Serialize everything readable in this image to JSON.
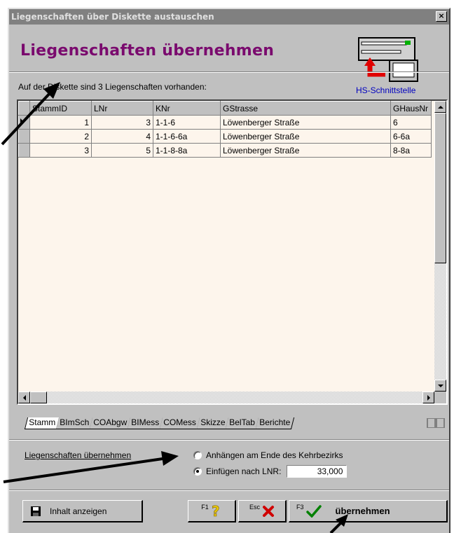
{
  "window": {
    "title": "Liegenschaften über Diskette austauschen",
    "close_glyph": "×"
  },
  "header": {
    "heading": "Liegenschaften übernehmen",
    "interface_label": "HS-Schnittstelle",
    "interface_icon": "computer-transfer-icon"
  },
  "info_text": "Auf der Diskette sind 3 Liegenschaften vorhanden:",
  "grid": {
    "columns": [
      "StammID",
      "LNr",
      "KNr",
      "GStrasse",
      "GHausNr"
    ],
    "rows": [
      {
        "stammid": "1",
        "lnr": "3",
        "knr": "1-1-6",
        "gstrasse": "Löwenberger Straße",
        "ghausnr": "6",
        "current": true
      },
      {
        "stammid": "2",
        "lnr": "4",
        "knr": "1-1-6-6a",
        "gstrasse": "Löwenberger Straße",
        "ghausnr": "6-6a",
        "current": false
      },
      {
        "stammid": "3",
        "lnr": "5",
        "knr": "1-1-8-8a",
        "gstrasse": "Löwenberger Straße",
        "ghausnr": "8-8a",
        "current": false
      }
    ]
  },
  "tabs": [
    "Stamm",
    "BImSch",
    "COAbgw",
    "BIMess",
    "COMess",
    "Skizze",
    "BelTab",
    "Berichte"
  ],
  "active_tab": "Stamm",
  "options": {
    "label": "Liegenschaften übernehmen",
    "radio_append": "Anhängen am Ende des Kehrbezirks",
    "radio_insert": "Einfügen nach LNR:",
    "selected": "insert",
    "lnr_value": "33,000"
  },
  "buttons": {
    "show_content": "Inhalt anzeigen",
    "help_key": "F1",
    "cancel_key": "Esc",
    "accept_key": "F3",
    "accept": "übernehmen"
  },
  "colors": {
    "heading": "#7a0a6e",
    "grid_background": "#fdf5ec",
    "interface_link": "#0000c0",
    "help_icon": "#e8c800",
    "cancel_icon": "#d00000",
    "accept_icon": "#008000"
  }
}
